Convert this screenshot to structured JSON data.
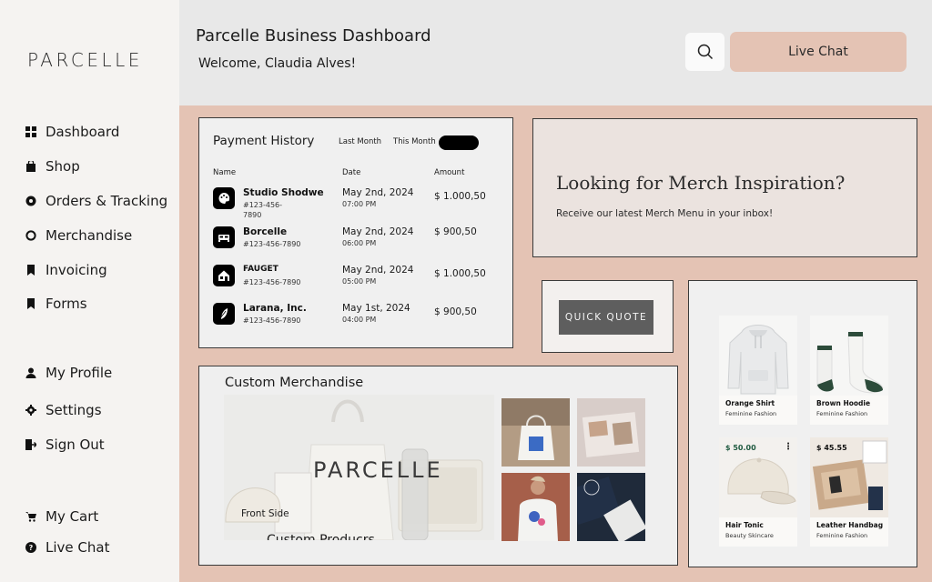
{
  "sidebar": {
    "logo": "PARCELLE",
    "nav": [
      {
        "label": "Dashboard",
        "icon": "grid-icon"
      },
      {
        "label": "Shop",
        "icon": "shopping-bag-icon"
      },
      {
        "label": "Orders & Tracking",
        "icon": "tracking-icon"
      },
      {
        "label": "Merchandise",
        "icon": "circle-icon"
      },
      {
        "label": "Invoicing",
        "icon": "bookmark-icon"
      },
      {
        "label": "Forms",
        "icon": "bookmark-icon"
      }
    ],
    "account": [
      {
        "label": "My Profile",
        "icon": "user-icon"
      },
      {
        "label": "Settings",
        "icon": "gear-icon"
      },
      {
        "label": "Sign Out",
        "icon": "sign-out-icon"
      }
    ],
    "bottom": [
      {
        "label": "My Cart",
        "icon": "cart-icon"
      },
      {
        "label": "Live Chat",
        "icon": "help-icon"
      }
    ]
  },
  "header": {
    "title": "Parcelle Business Dashboard",
    "welcome": "Welcome, Claudia Alves!",
    "live_chat_label": "Live Chat",
    "search_icon": "search-icon"
  },
  "payment_history": {
    "title": "Payment History",
    "tabs": [
      "Last Month",
      "This Month"
    ],
    "columns": [
      "Name",
      "Date",
      "Amount"
    ],
    "rows": [
      {
        "name": "Studio Shodwe",
        "id": "#123-456-7890",
        "date": "May 2nd, 2024",
        "time": "07:00 PM",
        "amount": "$ 1.000,50",
        "icon": "palette-icon"
      },
      {
        "name": "Borcelle",
        "id": "#123-456-7890",
        "date": "May 2nd, 2024",
        "time": "06:00 PM",
        "amount": "$ 900,50",
        "icon": "bed-icon"
      },
      {
        "name": "FAUGET",
        "id": "#123-456-7890",
        "date": "May 2nd, 2024",
        "time": "05:00 PM",
        "amount": "$ 1.000,50",
        "icon": "house-icon"
      },
      {
        "name": "Larana, Inc.",
        "id": "#123-456-7890",
        "date": "May 1st, 2024",
        "time": "04:00 PM",
        "amount": "$ 900,50",
        "icon": "leaf-icon"
      }
    ]
  },
  "merch_inspiration": {
    "title": "Looking for Merch Inspiration?",
    "subtitle": "Receive our latest Merch Menu in your inbox!"
  },
  "quick_quote": {
    "label": "QUICK QUOTE"
  },
  "products": [
    {
      "name": "Orange Shirt",
      "category": "Feminine Fashion",
      "price": ""
    },
    {
      "name": "Brown Hoodie",
      "category": "Feminine Fashion",
      "price": ""
    },
    {
      "name": "Hair Tonic",
      "category": "Beauty Skincare",
      "price": "$ 50.00"
    },
    {
      "name": "Leather Handbag",
      "category": "Feminine Fashion",
      "price": "$ 45.55"
    }
  ],
  "custom_merch": {
    "title": "Custom Merchandise",
    "hero_brand": "PARCELLE",
    "front_side": "Front Side",
    "caption": "Custom Producrs"
  },
  "colors": {
    "accent": "#e4c3b4",
    "sidebar_bg": "#f5f3f1",
    "header_bg": "#e8e8e8",
    "price_green": "#1f5a40"
  }
}
